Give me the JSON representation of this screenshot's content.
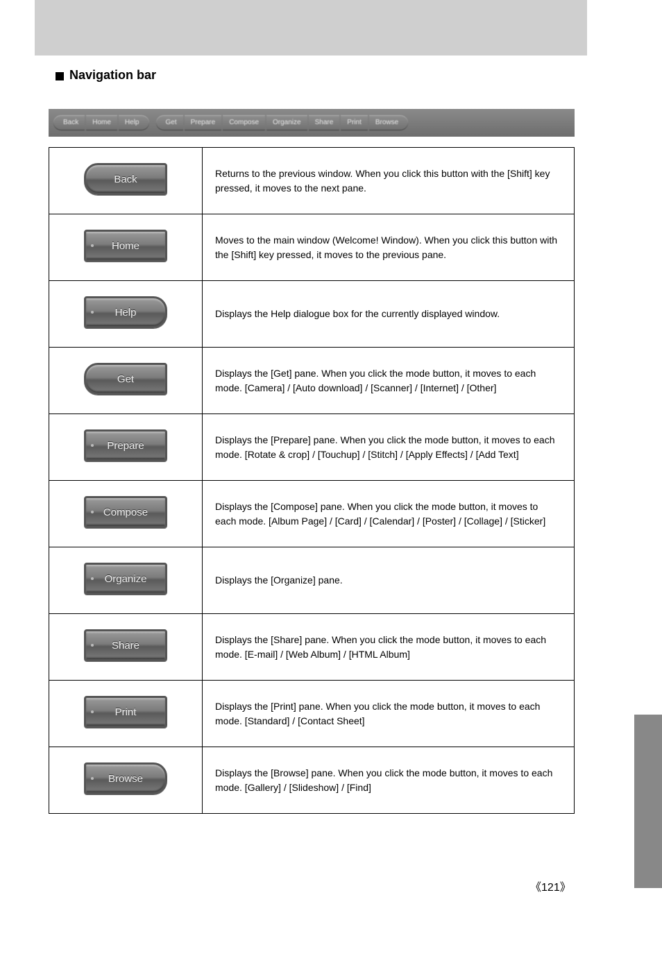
{
  "heading": "Navigation bar",
  "toolbar": {
    "left": [
      {
        "label": "Back"
      },
      {
        "label": "Home"
      },
      {
        "label": "Help"
      }
    ],
    "right": [
      {
        "label": "Get"
      },
      {
        "label": "Prepare"
      },
      {
        "label": "Compose"
      },
      {
        "label": "Organize"
      },
      {
        "label": "Share"
      },
      {
        "label": "Print"
      },
      {
        "label": "Browse"
      }
    ]
  },
  "rows": [
    {
      "btn": "Back",
      "shape": "rounded-left",
      "desc": "Returns to the previous window. When you click this button with the [Shift] key pressed, it moves to the next pane."
    },
    {
      "btn": "Home",
      "shape": "",
      "desc": "Moves to the main window (Welcome! Window). When you click this button with the [Shift] key pressed, it moves to the previous pane."
    },
    {
      "btn": "Help",
      "shape": "rounded-right",
      "desc": "Displays the Help dialogue box for the currently displayed window."
    },
    {
      "btn": "Get",
      "shape": "rounded-left",
      "desc": "Displays the [Get] pane. When you click the mode button, it moves to each mode. [Camera] / [Auto download] / [Scanner] / [Internet] / [Other]"
    },
    {
      "btn": "Prepare",
      "shape": "",
      "desc": "Displays the [Prepare] pane. When you click the mode button, it moves to each mode. [Rotate & crop] / [Touchup] / [Stitch] / [Apply Effects] / [Add Text]"
    },
    {
      "btn": "Compose",
      "shape": "",
      "desc": "Displays the [Compose] pane. When you click the mode button, it moves to each mode. [Album Page] / [Card] / [Calendar] / [Poster] / [Collage] / [Sticker]"
    },
    {
      "btn": "Organize",
      "shape": "",
      "desc": "Displays the [Organize] pane."
    },
    {
      "btn": "Share",
      "shape": "",
      "desc": "Displays the [Share] pane. When you click the mode button, it moves to each mode. [E-mail] / [Web Album] / [HTML Album]"
    },
    {
      "btn": "Print",
      "shape": "",
      "desc": "Displays the [Print] pane. When you click the mode button, it moves to each mode. [Standard] / [Contact Sheet]"
    },
    {
      "btn": "Browse",
      "shape": "rounded-right",
      "desc": "Displays the [Browse] pane. When you click the mode button, it moves to each mode. [Gallery] / [Slideshow] / [Find]"
    }
  ],
  "pagenum": "121"
}
